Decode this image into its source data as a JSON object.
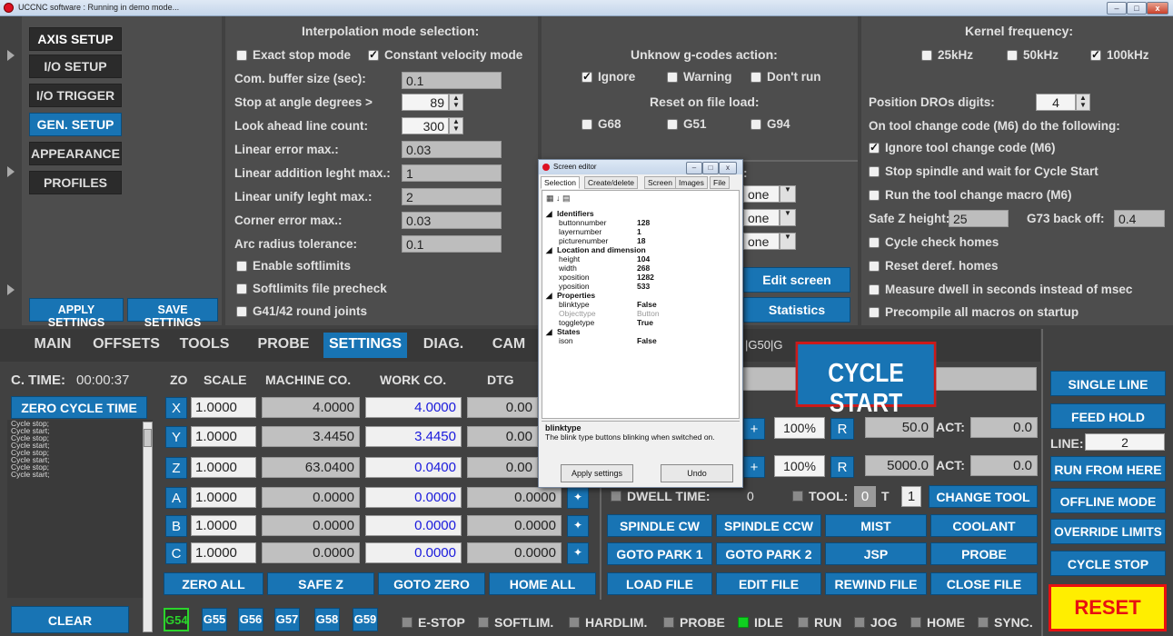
{
  "window": {
    "title": "UCCNC software : Running in demo mode...",
    "minimize": "–",
    "maximize": "□",
    "close": "x"
  },
  "side_menu": {
    "items": [
      "AXIS SETUP",
      "I/O SETUP",
      "I/O TRIGGER",
      "GEN. SETUP",
      "APPEARANCE",
      "PROFILES"
    ],
    "active": "GEN. SETUP",
    "apply": "APPLY SETTINGS",
    "save": "SAVE SETTINGS"
  },
  "interp": {
    "title": "Interpolation mode selection:",
    "exact_stop": "Exact stop mode",
    "const_vel": "Constant velocity mode",
    "rows": [
      {
        "label": "Com. buffer size (sec):",
        "value": "0.1"
      },
      {
        "label": "Stop at angle degrees >",
        "value": "89"
      },
      {
        "label": "Look ahead line count:",
        "value": "300"
      },
      {
        "label": "Linear error max.:",
        "value": "0.03"
      },
      {
        "label": "Linear addition leght max.:",
        "value": "1"
      },
      {
        "label": "Linear unify leght max.:",
        "value": "2"
      },
      {
        "label": "Corner error max.:",
        "value": "0.03"
      },
      {
        "label": "Arc radius tolerance:",
        "value": "0.1"
      }
    ],
    "enable_softlimits": "Enable softlimits",
    "softlimits_precheck": "Softlimits file precheck",
    "g41": "G41/42 round joints"
  },
  "gcode": {
    "title": "Unknow g-codes action:",
    "ignore": "Ignore",
    "warning": "Warning",
    "dont_run": "Don't run",
    "reset_title": "Reset on file load:",
    "g68": "G68",
    "g51": "G51",
    "g94": "G94",
    "dd1": "one",
    "dd2": "one",
    "dd3": "one",
    "edit_screen": "Edit screen",
    "statistics": "Statistics",
    "colon": ":"
  },
  "kernel": {
    "title": "Kernel frequency:",
    "f25": "25kHz",
    "f50": "50kHz",
    "f100": "100kHz",
    "dro_digits_label": "Position DROs digits:",
    "dro_digits": "4",
    "m6_title": "On tool change code (M6) do the following:",
    "opt_ignore": "Ignore tool change code (M6)",
    "opt_stop": "Stop spindle and wait for Cycle Start",
    "opt_macro": "Run the tool change macro (M6)",
    "safez_label": "Safe Z height:",
    "safez": "25",
    "g73_label": "G73 back off:",
    "g73": "0.4",
    "cycle_check": "Cycle check homes",
    "reset_deref": "Reset deref. homes",
    "dwell": "Measure dwell in seconds instead of msec",
    "precompile": "Precompile all macros on startup"
  },
  "tabs": [
    "MAIN",
    "OFFSETS",
    "TOOLS",
    "PROBE",
    "SETTINGS",
    "DIAG.",
    "CAM"
  ],
  "active_tab": "SETTINGS",
  "gcode_line_partial": "|G50|G",
  "cycle": {
    "time_label": "C. TIME:",
    "time": "00:00:37",
    "zero": "ZERO CYCLE TIME",
    "log": [
      "Cycle stop;",
      "Cycle start;",
      "Cycle stop;",
      "Cycle start;",
      "Cycle stop;",
      "Cycle start;",
      "Cycle stop;",
      "Cycle start;"
    ],
    "clear": "CLEAR"
  },
  "dro_headers": {
    "zo": "ZO",
    "scale": "SCALE",
    "machine": "MACHINE CO.",
    "work": "WORK CO.",
    "dtg": "DTG"
  },
  "axes": [
    {
      "name": "X",
      "scale": "1.0000",
      "machine": "4.0000",
      "work": "4.0000",
      "dtg": "0.00"
    },
    {
      "name": "Y",
      "scale": "1.0000",
      "machine": "3.4450",
      "work": "3.4450",
      "dtg": "0.00"
    },
    {
      "name": "Z",
      "scale": "1.0000",
      "machine": "63.0400",
      "work": "0.0400",
      "dtg": "0.00"
    },
    {
      "name": "A",
      "scale": "1.0000",
      "machine": "0.0000",
      "work": "0.0000",
      "dtg": "0.0000"
    },
    {
      "name": "B",
      "scale": "1.0000",
      "machine": "0.0000",
      "work": "0.0000",
      "dtg": "0.0000"
    },
    {
      "name": "C",
      "scale": "1.0000",
      "machine": "0.0000",
      "work": "0.0000",
      "dtg": "0.0000"
    }
  ],
  "dro_buttons": [
    "ZERO ALL",
    "SAFE Z",
    "GOTO ZERO",
    "HOME ALL"
  ],
  "ctrl": {
    "cycle_start": "CYCLE START",
    "plus": "+",
    "r": "R",
    "feed_pct": "100%",
    "feed": "50.0",
    "act_label": "ACT:",
    "feed_act": "0.0",
    "spindle_pct": "100%",
    "spindle": "5000.0",
    "spindle_act": "0.0",
    "dwell_label": "DWELL TIME:",
    "dwell": "0",
    "tool_label": "TOOL:",
    "tool_a": "0",
    "t_label": "T",
    "tool_b": "1",
    "change_tool": "CHANGE TOOL",
    "buttons": [
      [
        "SPINDLE CW",
        "SPINDLE CCW",
        "MIST",
        "COOLANT"
      ],
      [
        "GOTO PARK 1",
        "GOTO PARK 2",
        "JSP",
        "PROBE"
      ],
      [
        "LOAD FILE",
        "EDIT FILE",
        "REWIND FILE",
        "CLOSE FILE"
      ]
    ]
  },
  "right": {
    "single_line": "SINGLE LINE",
    "feed_hold": "FEED HOLD",
    "line_label": "LINE:",
    "line": "2",
    "run_from_here": "RUN FROM HERE",
    "offline": "OFFLINE MODE",
    "override": "OVERRIDE LIMITS",
    "cycle_stop": "CYCLE STOP",
    "reset": "RESET"
  },
  "g_codes": [
    "G54",
    "G55",
    "G56",
    "G57",
    "G58",
    "G59"
  ],
  "active_g": "G54",
  "status": {
    "estop": "E-STOP",
    "softlim": "SOFTLIM.",
    "hardlim": "HARDLIM.",
    "probe": "PROBE",
    "idle": "IDLE",
    "run": "RUN",
    "jog": "JOG",
    "home": "HOME",
    "sync": "SYNC."
  },
  "editor": {
    "title": "Screen editor",
    "tabs": [
      "Selection",
      "Create/delete",
      "Screen",
      "Images",
      "File"
    ],
    "rows": [
      {
        "cat": true,
        "k": "Identifiers"
      },
      {
        "k": "buttonnumber",
        "v": "128"
      },
      {
        "k": "layernumber",
        "v": "1"
      },
      {
        "k": "picturenumber",
        "v": "18"
      },
      {
        "cat": true,
        "k": "Location and dimension"
      },
      {
        "k": "height",
        "v": "104"
      },
      {
        "k": "width",
        "v": "268"
      },
      {
        "k": "xposition",
        "v": "1282"
      },
      {
        "k": "yposition",
        "v": "533"
      },
      {
        "cat": true,
        "k": "Properties"
      },
      {
        "k": "blinktype",
        "v": "False"
      },
      {
        "k": "Objecttype",
        "v": "Button",
        "dim": true
      },
      {
        "k": "toggletype",
        "v": "True"
      },
      {
        "cat": true,
        "k": "States"
      },
      {
        "k": "ison",
        "v": "False"
      }
    ],
    "desc_title": "blinktype",
    "desc": "The blink type buttons blinking when switched on.",
    "apply": "Apply settings",
    "undo": "Undo"
  },
  "colors": {
    "blue": "#1874b4",
    "panel": "#414141",
    "led_on": "#10d020",
    "reset_bg": "#ffee00",
    "reset_text": "#e81010"
  }
}
